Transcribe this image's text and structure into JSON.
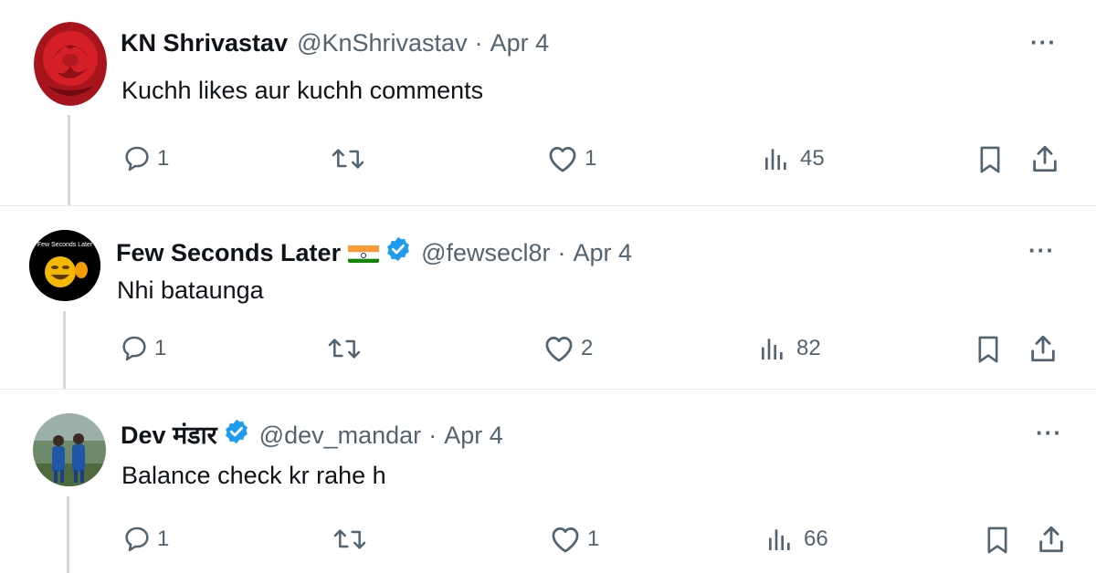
{
  "tweets": [
    {
      "name": "KN Shrivastav",
      "handle": "@KnShrivastav",
      "sep": "·",
      "date": "Apr 4",
      "text": "Kuchh likes aur kuchh comments",
      "replies": "1",
      "reposts": "",
      "likes": "1",
      "views": "45",
      "more": "···"
    },
    {
      "name": "Few Seconds Later",
      "handle": "@fewsecl8r",
      "sep": "·",
      "date": "Apr 4",
      "text": "Nhi bataunga",
      "replies": "1",
      "reposts": "",
      "likes": "2",
      "views": "82",
      "more": "···",
      "avatar_text": "Few Seconds Later"
    },
    {
      "name": "Dev मंडार",
      "handle": "@dev_mandar",
      "sep": "·",
      "date": "Apr 4",
      "text": "Balance check kr rahe h",
      "replies": "1",
      "reposts": "",
      "likes": "1",
      "views": "66",
      "more": "···"
    }
  ],
  "colors": {
    "secondary_text": "#536471",
    "verified_blue": "#1d9bf0",
    "thread_line": "#cfd9de"
  }
}
